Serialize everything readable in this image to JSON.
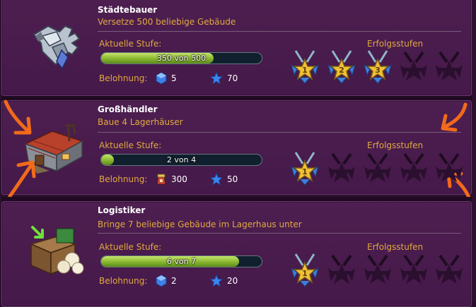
{
  "labels": {
    "current_level": "Aktuelle Stufe:",
    "reward": "Belohnung:",
    "achievement_levels": "Erfolgsstufen"
  },
  "achievements": [
    {
      "title": "Städtebauer",
      "description": "Versetze 500 beliebige Gebäude",
      "progress_text": "350 von 500",
      "progress_fraction": 0.7,
      "reward_1_value": "5",
      "reward_1_icon": "gem-icon",
      "reward_2_value": "70",
      "reward_2_icon": "star-icon",
      "medals": [
        "1",
        "2",
        "3",
        "",
        ""
      ],
      "medals_earned": 3,
      "icon": "gauntlet-icon"
    },
    {
      "title": "Großhändler",
      "description": "Baue 4 Lagerhäuser",
      "progress_text": "2 von 4",
      "progress_fraction": 0.08,
      "reward_1_value": "300",
      "reward_1_icon": "goods-sack-icon",
      "reward_2_value": "50",
      "reward_2_icon": "star-icon",
      "medals": [
        "1",
        "",
        "",
        "",
        ""
      ],
      "medals_earned": 1,
      "icon": "warehouse-icon"
    },
    {
      "title": "Logistiker",
      "description": "Bringe 7 beliebige Gebäude im Lagerhaus unter",
      "progress_text": "6 von 7",
      "progress_fraction": 0.86,
      "reward_1_value": "2",
      "reward_1_icon": "gem-icon",
      "reward_2_value": "20",
      "reward_2_icon": "star-icon",
      "medals": [
        "1",
        "",
        "",
        "",
        ""
      ],
      "medals_earned": 1,
      "icon": "storage-crate-icon"
    }
  ],
  "colors": {
    "panel_bg": "#4d1f50",
    "label_gold": "#e1a93f",
    "progress_green": "#88b62f",
    "annotation_orange": "#f26a1b"
  }
}
